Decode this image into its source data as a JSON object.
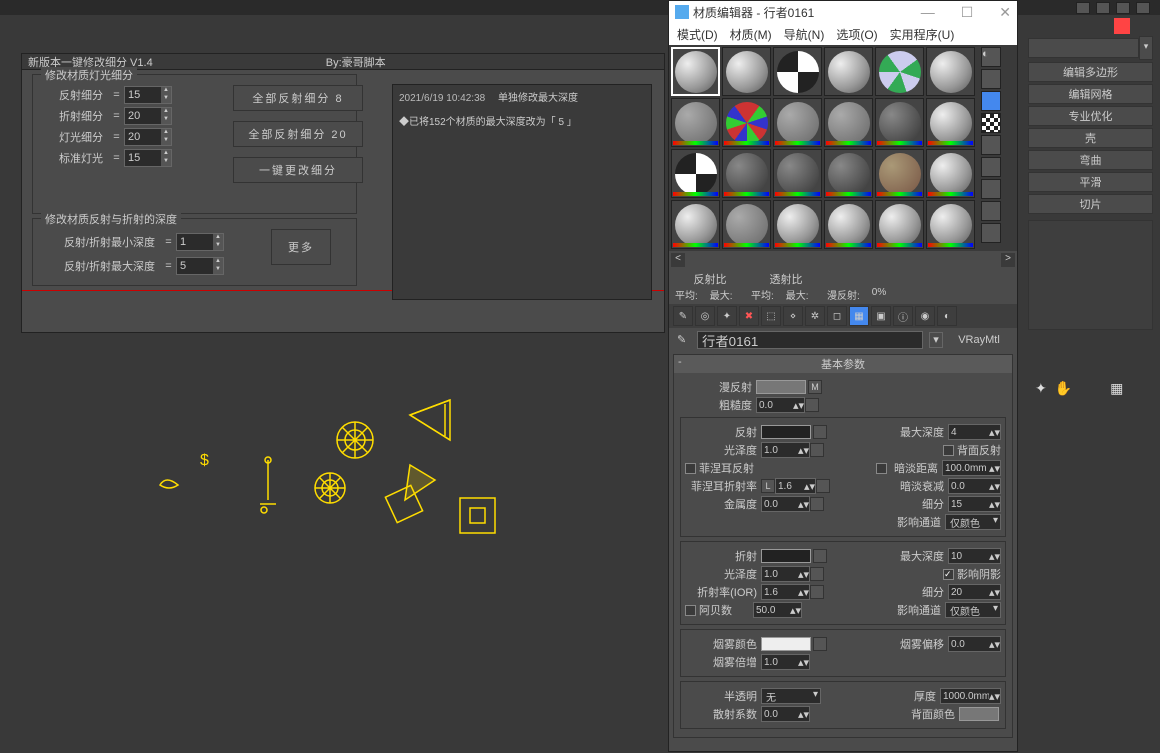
{
  "script": {
    "title": "新版本一键修改细分 V1.4",
    "by": "By:豪哥脚本",
    "fs1_legend": "修改材质灯光细分",
    "rows": [
      {
        "label": "反射细分",
        "val": "15"
      },
      {
        "label": "折射细分",
        "val": "20"
      },
      {
        "label": "灯光细分",
        "val": "20"
      },
      {
        "label": "标准灯光",
        "val": "15"
      }
    ],
    "btn_all_refl_8": "全部反射细分 8",
    "btn_all_refl_20": "全部反射细分 20",
    "btn_onekey": "一键更改细分",
    "fs2_legend": "修改材质反射与折射的深度",
    "min_depth": "反射/折射最小深度",
    "max_depth": "反射/折射最大深度",
    "min_val": "1",
    "max_val": "5",
    "btn_more": "更多",
    "log_ts": "2021/6/19 10:42:38",
    "log_head": "单独修改最大深度",
    "log_line": "◆已将152个材质的最大深度改为「 5 」"
  },
  "mat": {
    "title": "材质编辑器 - 行者0161",
    "menus": [
      "模式(D)",
      "材质(M)",
      "导航(N)",
      "选项(O)",
      "实用程序(U)"
    ],
    "ratio": {
      "refl": "反射比",
      "trans": "透射比",
      "avg": "平均:",
      "max": "最大:",
      "diffuse": "漫反射:",
      "pct": "0%"
    },
    "name": "行者0161",
    "type": "VRayMtl",
    "rollout_basic": "基本参数",
    "diffuse": "漫反射",
    "m": "M",
    "rough": "粗糙度",
    "rough_v": "0.0",
    "refl": "反射",
    "gloss": "光泽度",
    "gloss_v": "1.0",
    "fresnel": "菲涅耳反射",
    "frIOR": "菲涅耳折射率",
    "frIOR_l": "L",
    "frIOR_v": "1.6",
    "metal": "金属度",
    "metal_v": "0.0",
    "maxd": "最大深度",
    "maxd_refl_v": "4",
    "backrefl": "背面反射",
    "dimdist": "暗淡距离",
    "dimdist_v": "100.0mm",
    "dimfall": "暗淡衰减",
    "dimfall_v": "0.0",
    "subdiv": "细分",
    "subdiv_v": "15",
    "affect": "影响通道",
    "affect_v": "仅颜色",
    "refr": "折射",
    "refr_maxd_v": "10",
    "affshadow": "影响阴影",
    "ior": "折射率(IOR)",
    "ior_v": "1.6",
    "refr_subdiv_v": "20",
    "abbe": "阿贝数",
    "abbe_v": "50.0",
    "fogcol": "烟雾颜色",
    "fogbias": "烟雾偏移",
    "fogbias_v": "0.0",
    "fogmult": "烟雾倍增",
    "fogmult_v": "1.0",
    "translucent": "半透明",
    "translucent_v": "无",
    "thick": "厚度",
    "thick_v": "1000.0mm",
    "scatter": "散射系数",
    "scatter_v": "0.0",
    "backcol": "背面颜色"
  },
  "mod": {
    "buttons": [
      "编辑多边形",
      "编辑网格",
      "专业优化",
      "壳",
      "弯曲",
      "平滑",
      "切片"
    ]
  }
}
